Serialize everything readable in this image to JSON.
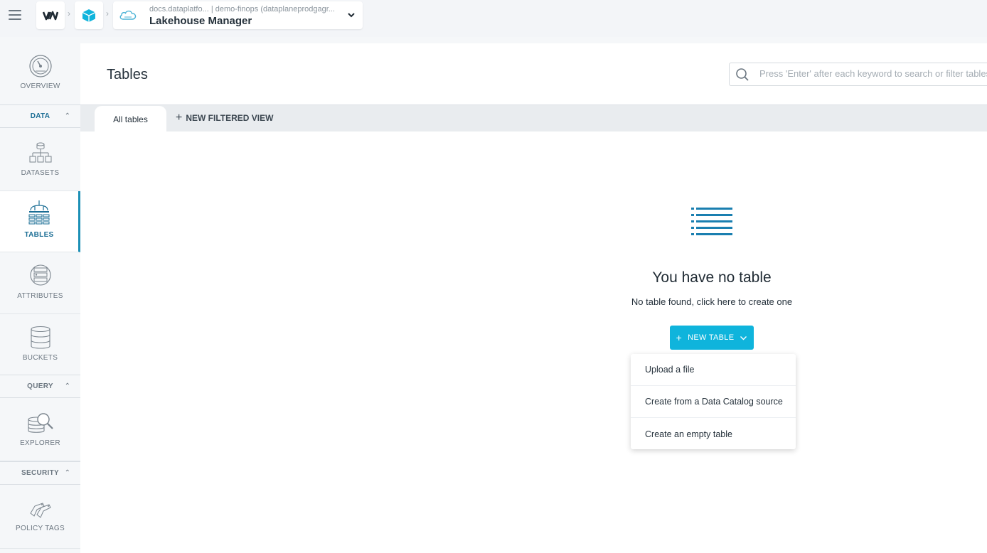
{
  "topbar": {
    "project_path": "docs.dataplatfo... | demo-finops (dataplaneprodgagr...",
    "project_name": "Lakehouse Manager"
  },
  "sidebar": {
    "overview": "OVERVIEW",
    "sections": {
      "data": "DATA",
      "query": "QUERY",
      "security": "SECURITY"
    },
    "items": {
      "datasets": "DATASETS",
      "tables": "TABLES",
      "attributes": "ATTRIBUTES",
      "buckets": "BUCKETS",
      "explorer": "EXPLORER",
      "policy_tags": "POLICY TAGS"
    },
    "active": "tables"
  },
  "main": {
    "title": "Tables",
    "search_placeholder": "Press 'Enter' after each keyword to search or filter tables",
    "tabs": {
      "active": "All tables",
      "new_view": "NEW FILTERED VIEW"
    },
    "empty": {
      "title": "You have no table",
      "subtitle": "No table found, click here to create one"
    },
    "new_table_button": "NEW TABLE",
    "menu": [
      "Upload a file",
      "Create from a Data Catalog source",
      "Create an empty table"
    ]
  },
  "colors": {
    "accent": "#0fb4dc",
    "active_nav": "#1a6d94"
  }
}
